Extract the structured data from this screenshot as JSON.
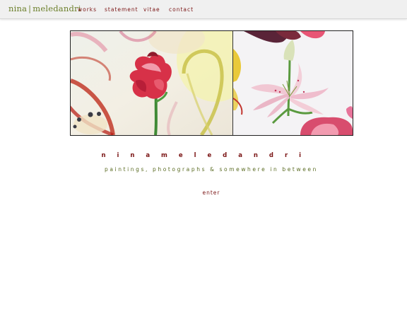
{
  "header": {
    "logo_name_first": "nina",
    "logo_separator": "|",
    "logo_name_last": "meledandri",
    "nav": [
      {
        "label": "works"
      },
      {
        "label": "statement"
      },
      {
        "label": "vitae"
      },
      {
        "label": "contact"
      }
    ]
  },
  "main": {
    "artist_name": "n i n a   m e l e d a n d r i",
    "tagline": "paintings, photographs & somewhere in between",
    "enter_label": "enter"
  },
  "colors": {
    "accent_red": "#7a1414",
    "accent_olive": "#6b7f2a",
    "topbar_bg": "#f0f0f0"
  }
}
